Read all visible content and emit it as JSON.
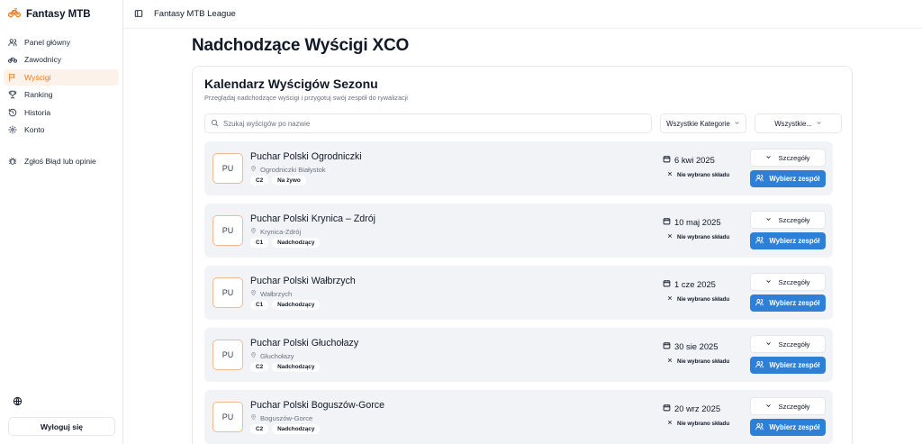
{
  "app": {
    "name": "Fantasy MTB",
    "header_title": "Fantasy MTB League"
  },
  "colors": {
    "accent": "#ea7b24",
    "primary_button": "#2e7fd6",
    "race_bg": "#f1f3f6"
  },
  "sidebar": {
    "items": [
      {
        "label": "Panel główny",
        "icon": "users-icon",
        "active": false
      },
      {
        "label": "Zawodnicy",
        "icon": "bike-icon",
        "active": false
      },
      {
        "label": "Wyścigi",
        "icon": "flag-icon",
        "active": true
      },
      {
        "label": "Ranking",
        "icon": "trophy-icon",
        "active": false
      },
      {
        "label": "Historia",
        "icon": "history-icon",
        "active": false
      },
      {
        "label": "Konto",
        "icon": "settings-icon",
        "active": false
      }
    ],
    "report_label": "Zgłoś Błąd lub opinie",
    "logout_label": "Wyloguj się"
  },
  "main": {
    "page_title": "Nadchodzące Wyścigi XCO",
    "card_title": "Kalendarz Wyścigów Sezonu",
    "card_subtitle": "Przeglądaj nadchodzące wyścigi i przygotuj swój zespół do rywalizacji",
    "search_placeholder": "Szukaj wyścigów po nazwie",
    "category_select": "Wszystkie Kategorie",
    "status_select": "Wszystkie..."
  },
  "races": [
    {
      "badge": "PU",
      "name": "Puchar Polski Ogrodniczki",
      "location": "Ogrodniczki Białystok",
      "category": "C2",
      "status": "Na żywo",
      "date": "6 kwi 2025",
      "team_status": "Nie wybrano składu",
      "details_label": "Szczegóły",
      "pick_label": "Wybierz zespół"
    },
    {
      "badge": "PU",
      "name": "Puchar Polski Krynica – Zdrój",
      "location": "Krynica-Zdrój",
      "category": "C1",
      "status": "Nadchodzący",
      "date": "10 maj 2025",
      "team_status": "Nie wybrano składu",
      "details_label": "Szczegóły",
      "pick_label": "Wybierz zespół"
    },
    {
      "badge": "PU",
      "name": "Puchar Polski Wałbrzych",
      "location": "Wałbrzych",
      "category": "C1",
      "status": "Nadchodzący",
      "date": "1 cze 2025",
      "team_status": "Nie wybrano składu",
      "details_label": "Szczegóły",
      "pick_label": "Wybierz zespół"
    },
    {
      "badge": "PU",
      "name": "Puchar Polski Głuchołazy",
      "location": "Głuchołazy",
      "category": "C2",
      "status": "Nadchodzący",
      "date": "30 sie 2025",
      "team_status": "Nie wybrano składu",
      "details_label": "Szczegóły",
      "pick_label": "Wybierz zespół"
    },
    {
      "badge": "PU",
      "name": "Puchar Polski Boguszów-Gorce",
      "location": "Boguszów-Gorce",
      "category": "C2",
      "status": "Nadchodzący",
      "date": "20 wrz 2025",
      "team_status": "Nie wybrano składu",
      "details_label": "Szczegóły",
      "pick_label": "Wybierz zespół"
    }
  ]
}
